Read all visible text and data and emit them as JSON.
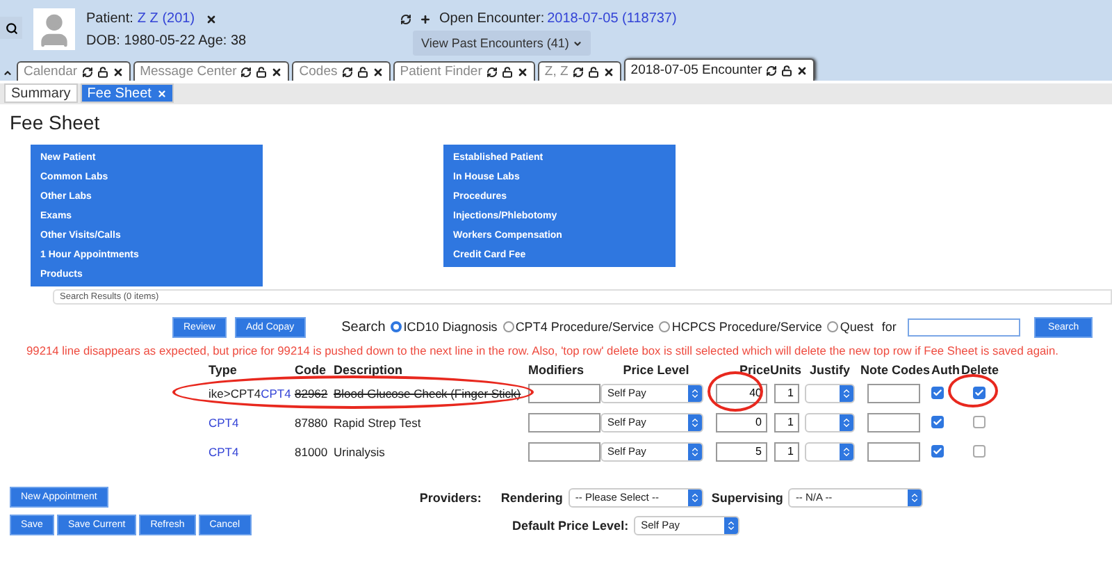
{
  "header": {
    "patient_label": "Patient:",
    "patient_name": "Z Z (201)",
    "dob_line": "DOB: 1980-05-22 Age: 38",
    "encounter_label": "Open Encounter:",
    "encounter_link": "2018-07-05 (118737)",
    "past_button": "View Past Encounters",
    "past_count": "(41)"
  },
  "tabs": [
    {
      "label": "Calendar",
      "selected": false
    },
    {
      "label": "Message Center",
      "selected": false
    },
    {
      "label": "Codes",
      "selected": false
    },
    {
      "label": "Patient Finder",
      "selected": false
    },
    {
      "label": "Z, Z",
      "selected": false
    },
    {
      "label": "2018-07-05 Encounter",
      "selected": true
    }
  ],
  "subtabs": [
    {
      "label": "Summary",
      "selected": false,
      "closable": false
    },
    {
      "label": "Fee Sheet",
      "selected": true,
      "closable": true
    }
  ],
  "title": "Fee Sheet",
  "left_categories": [
    "New Patient",
    "Common Labs",
    "Other Labs",
    "Exams",
    "Other Visits/Calls",
    "1 Hour Appointments",
    "Products"
  ],
  "right_categories": [
    "Established Patient",
    "In House Labs",
    "Procedures",
    "Injections/Phlebotomy",
    "Workers Compensation",
    "Credit Card Fee"
  ],
  "search_results": "Search Results (0 items)",
  "action_buttons": [
    "Review",
    "Add Copay"
  ],
  "search": {
    "label": "Search",
    "options": [
      {
        "label": "ICD10 Diagnosis",
        "selected": true
      },
      {
        "label": "CPT4 Procedure/Service",
        "selected": false
      },
      {
        "label": "HCPCS Procedure/Service",
        "selected": false
      },
      {
        "label": "Quest",
        "selected": false
      }
    ],
    "for_label": "for",
    "button": "Search"
  },
  "note": "99214 line disappears as expected, but price for 99214 is pushed down to the next line in the row. Also, 'top row' delete box is still selected which will delete the new top row if Fee Sheet is saved again.",
  "columns": [
    "Type",
    "Code",
    "Description",
    "Modifiers",
    "Price Level",
    "Price",
    "Units",
    "Justify",
    "Note Codes",
    "Auth",
    "Delete"
  ],
  "rows": [
    {
      "type": "ike>CPT4",
      "type_linked": false,
      "type_extra": "CPT4",
      "code": "82962",
      "description": "Blood Glucose Check (Finger Stick)",
      "struck": true,
      "price_level": "Self Pay",
      "price": "40",
      "units": "1",
      "auth": true,
      "delete": true,
      "circled": true
    },
    {
      "type": "CPT4",
      "type_linked": true,
      "code": "87880",
      "description": "Rapid Strep Test",
      "struck": false,
      "price_level": "Self Pay",
      "price": "0",
      "units": "1",
      "auth": true,
      "delete": false,
      "circled": false
    },
    {
      "type": "CPT4",
      "type_linked": true,
      "code": "81000",
      "description": "Urinalysis",
      "struck": false,
      "price_level": "Self Pay",
      "price": "5",
      "units": "1",
      "auth": true,
      "delete": false,
      "circled": false
    }
  ],
  "new_appointment": "New Appointment",
  "providers": {
    "label": "Providers:",
    "rendering_label": "Rendering",
    "rendering_value": "-- Please Select --",
    "supervising_label": "Supervising",
    "supervising_value": "-- N/A --"
  },
  "default_price": {
    "label": "Default Price Level:",
    "value": "Self Pay"
  },
  "bottom_buttons": [
    "Save",
    "Save Current",
    "Refresh",
    "Cancel"
  ]
}
